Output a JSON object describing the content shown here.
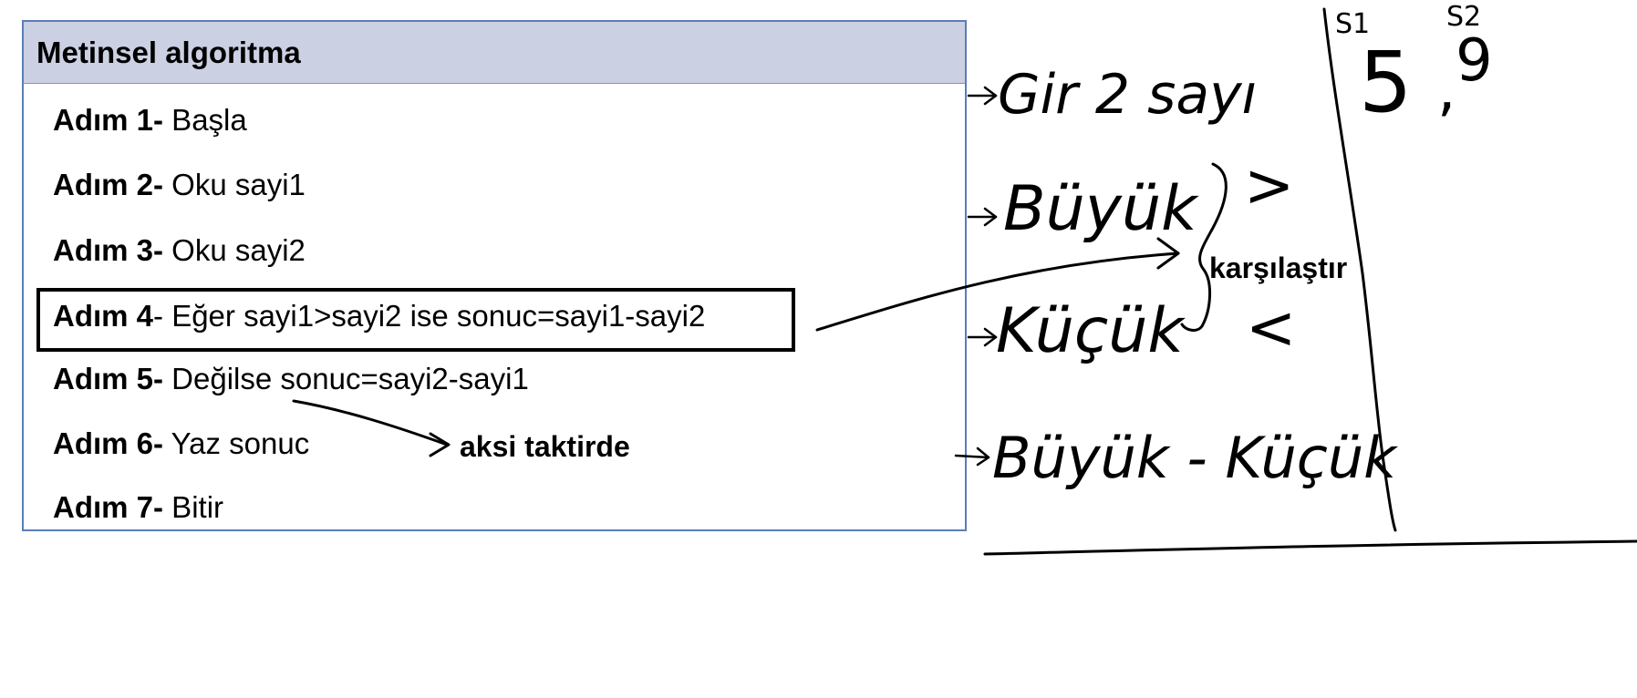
{
  "table": {
    "header": "Metinsel algoritma",
    "steps": [
      {
        "num": "Adım 1-",
        "text": " Başla"
      },
      {
        "num": "Adım 2-",
        "text": " Oku sayi1"
      },
      {
        "num": "Adım 3-",
        "text": " Oku sayi2"
      },
      {
        "num": "Adım 4",
        "text": "- Eğer sayi1>sayi2 ise sonuc=sayi1-sayi2"
      },
      {
        "num": "Adım 5-",
        "text": " Değilse sonuc=sayi2-sayi1"
      },
      {
        "num": "Adım 6-",
        "text": " Yaz sonuc"
      },
      {
        "num": "Adım 7-",
        "text": " Bitir"
      }
    ]
  },
  "annotations": {
    "aksi": "aksi taktirde",
    "karsilastir": "karşılaştır"
  },
  "handwriting": {
    "line1": "Gir 2 sayı",
    "line2": "Büyük",
    "line3": "Küçük",
    "line4": "Büyük - Küçük",
    "gt": ">",
    "lt": "<",
    "s1": "S1",
    "s2": "S2",
    "five": "5",
    "comma": ",",
    "nine": "9"
  }
}
